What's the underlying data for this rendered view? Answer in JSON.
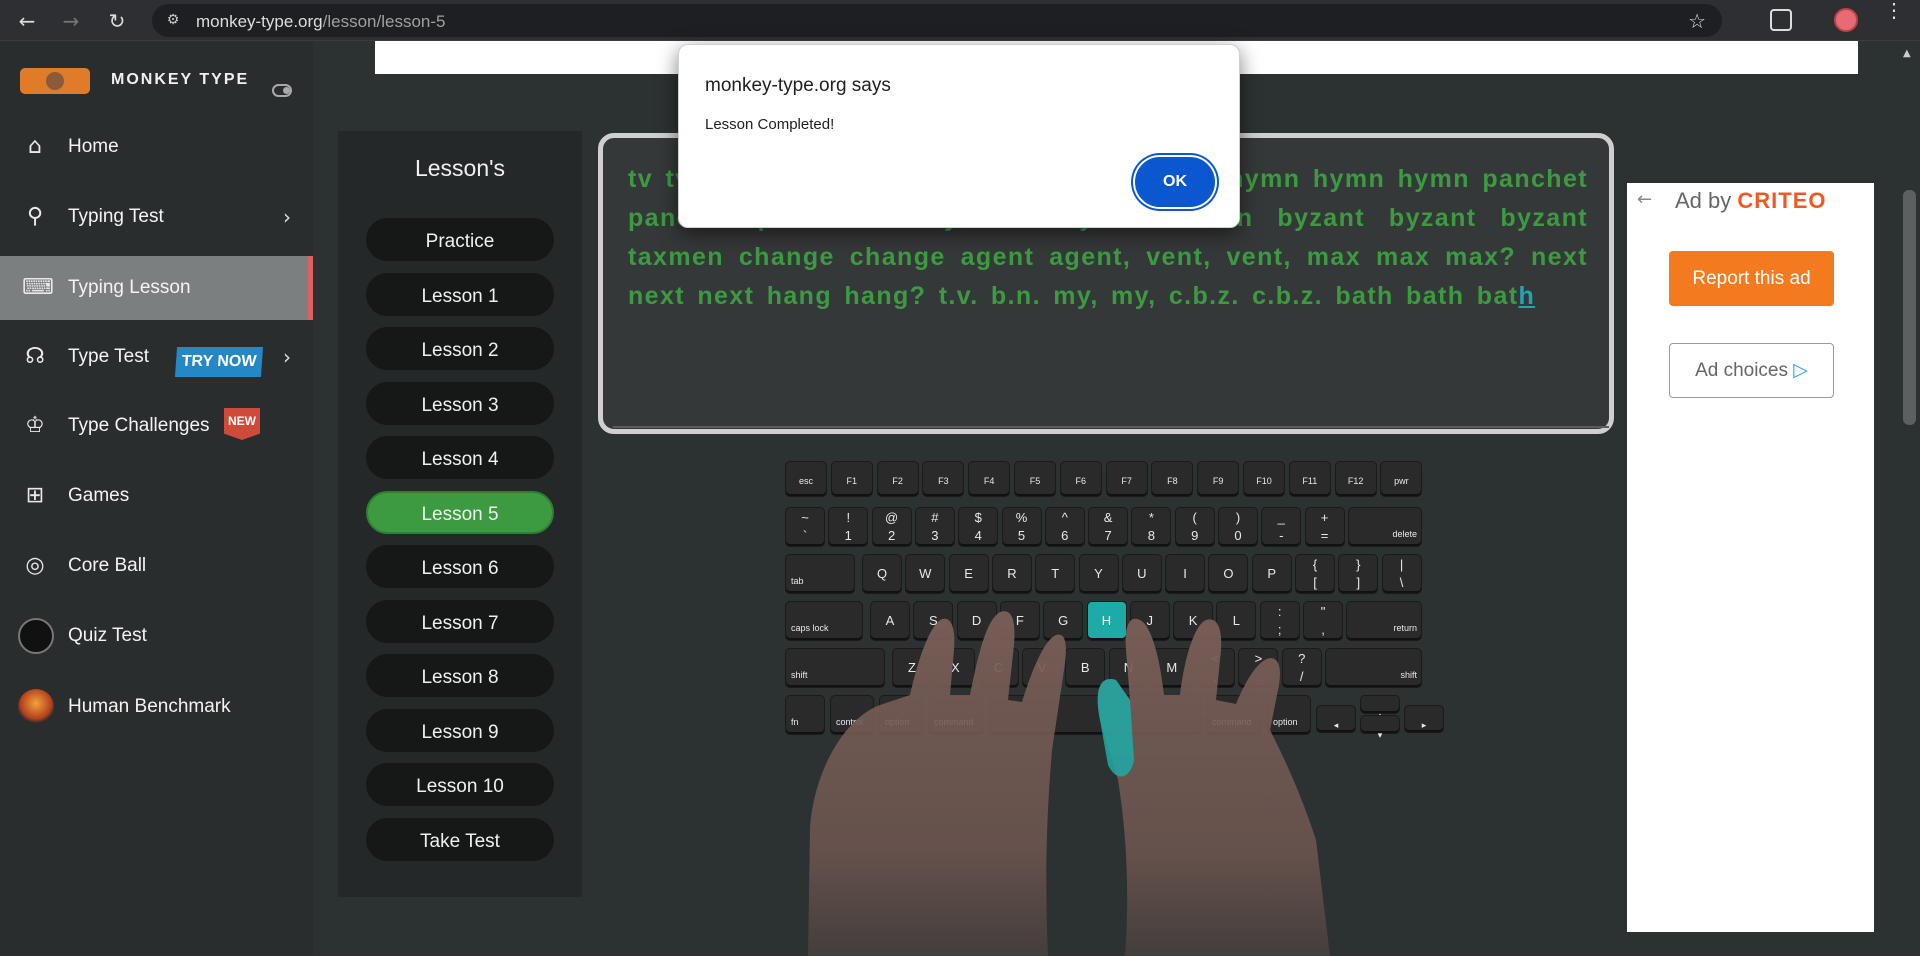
{
  "browser": {
    "url_host": "monkey-type.org",
    "url_path": "/lesson/lesson-5",
    "back_icon": "←",
    "forward_icon": "→",
    "reload_icon": "↻",
    "site_info_icon": "⚙",
    "star_icon": "☆",
    "menu_icon": "⋮"
  },
  "sidebar": {
    "brand": "MONKEY TYPE",
    "items": [
      {
        "label": "Home",
        "icon": "⌂"
      },
      {
        "label": "Typing Test",
        "icon": "⚲",
        "arrow": "›"
      },
      {
        "label": "Typing Lesson",
        "icon": "⌨"
      },
      {
        "label": "Type Test",
        "icon": "☊",
        "arrow": "›",
        "badge": "TRY NOW"
      },
      {
        "label": "Type Challenges",
        "icon": "♔",
        "badge": "NEW"
      },
      {
        "label": "Games",
        "icon": "⊞"
      },
      {
        "label": "Core Ball",
        "icon": "◎"
      },
      {
        "label": "Quiz Test",
        "icon": ""
      },
      {
        "label": "Human Benchmark",
        "icon": ""
      }
    ]
  },
  "lessons": {
    "title": "Lesson's",
    "items": [
      "Practice",
      "Lesson 1",
      "Lesson 2",
      "Lesson 3",
      "Lesson 4",
      "Lesson 5",
      "Lesson 6",
      "Lesson 7",
      "Lesson 8",
      "Lesson 9",
      "Lesson 10",
      "Take Test"
    ],
    "current": "Lesson 5"
  },
  "typing": {
    "text_typed": "tv tv tv myth myth myth hymn hymn hymn hymn hymn hymn panchet panchet panchet ecthyma ecthyma taxmen byzant byzant byzant taxmen change change agent agent, vent, vent, max max max? next next next hang hang? t.v. b.n. my, my, c.b.z. c.b.z. bath bath bat",
    "text_cursor": "h"
  },
  "keyboard": {
    "highlighted_key": "H",
    "row1": [
      "esc",
      "F1",
      "F2",
      "F3",
      "F4",
      "F5",
      "F6",
      "F7",
      "F8",
      "F9",
      "F10",
      "F11",
      "F12",
      "pwr"
    ],
    "row2": [
      [
        "~",
        "`"
      ],
      [
        "!",
        "1"
      ],
      [
        "@",
        "2"
      ],
      [
        "#",
        "3"
      ],
      [
        "$",
        "4"
      ],
      [
        "%",
        "5"
      ],
      [
        "^",
        "6"
      ],
      [
        "&",
        "7"
      ],
      [
        "*",
        "8"
      ],
      [
        "(",
        "9"
      ],
      [
        ")",
        "0"
      ],
      [
        "_",
        "-"
      ],
      [
        "+",
        "="
      ]
    ],
    "row2_end": "delete",
    "row3_start": "tab",
    "row3": [
      "Q",
      "W",
      "E",
      "R",
      "T",
      "Y",
      "U",
      "I",
      "O",
      "P"
    ],
    "row3_pairs": [
      [
        "{",
        "["
      ],
      [
        "}",
        "]"
      ],
      [
        "|",
        "\\"
      ]
    ],
    "row4_start": "caps lock",
    "row4": [
      "A",
      "S",
      "D",
      "F",
      "G",
      "H",
      "J",
      "K",
      "L"
    ],
    "row4_pairs": [
      [
        ":",
        ";"
      ],
      [
        "\"",
        ","
      ]
    ],
    "row4_end": "return",
    "row5_start": "shift",
    "row5": [
      "Z",
      "X",
      "C",
      "V",
      "B",
      "N",
      "M"
    ],
    "row5_pairs": [
      [
        "<",
        ","
      ],
      [
        ">",
        "."
      ],
      [
        "?",
        "/"
      ]
    ],
    "row5_end": "shift",
    "row6": [
      "fn",
      "control",
      "option",
      "command",
      "",
      "command",
      "option"
    ],
    "arrows": [
      "◂",
      "▴",
      "▾",
      "▸"
    ]
  },
  "ad": {
    "back_icon": "←",
    "ad_by": "Ad by",
    "brand": "CRITEO",
    "report": "Report this ad",
    "choices": "Ad choices",
    "choices_icon": "▷"
  },
  "dialog": {
    "title": "monkey-type.org says",
    "message": "Lesson Completed!",
    "ok": "OK"
  }
}
